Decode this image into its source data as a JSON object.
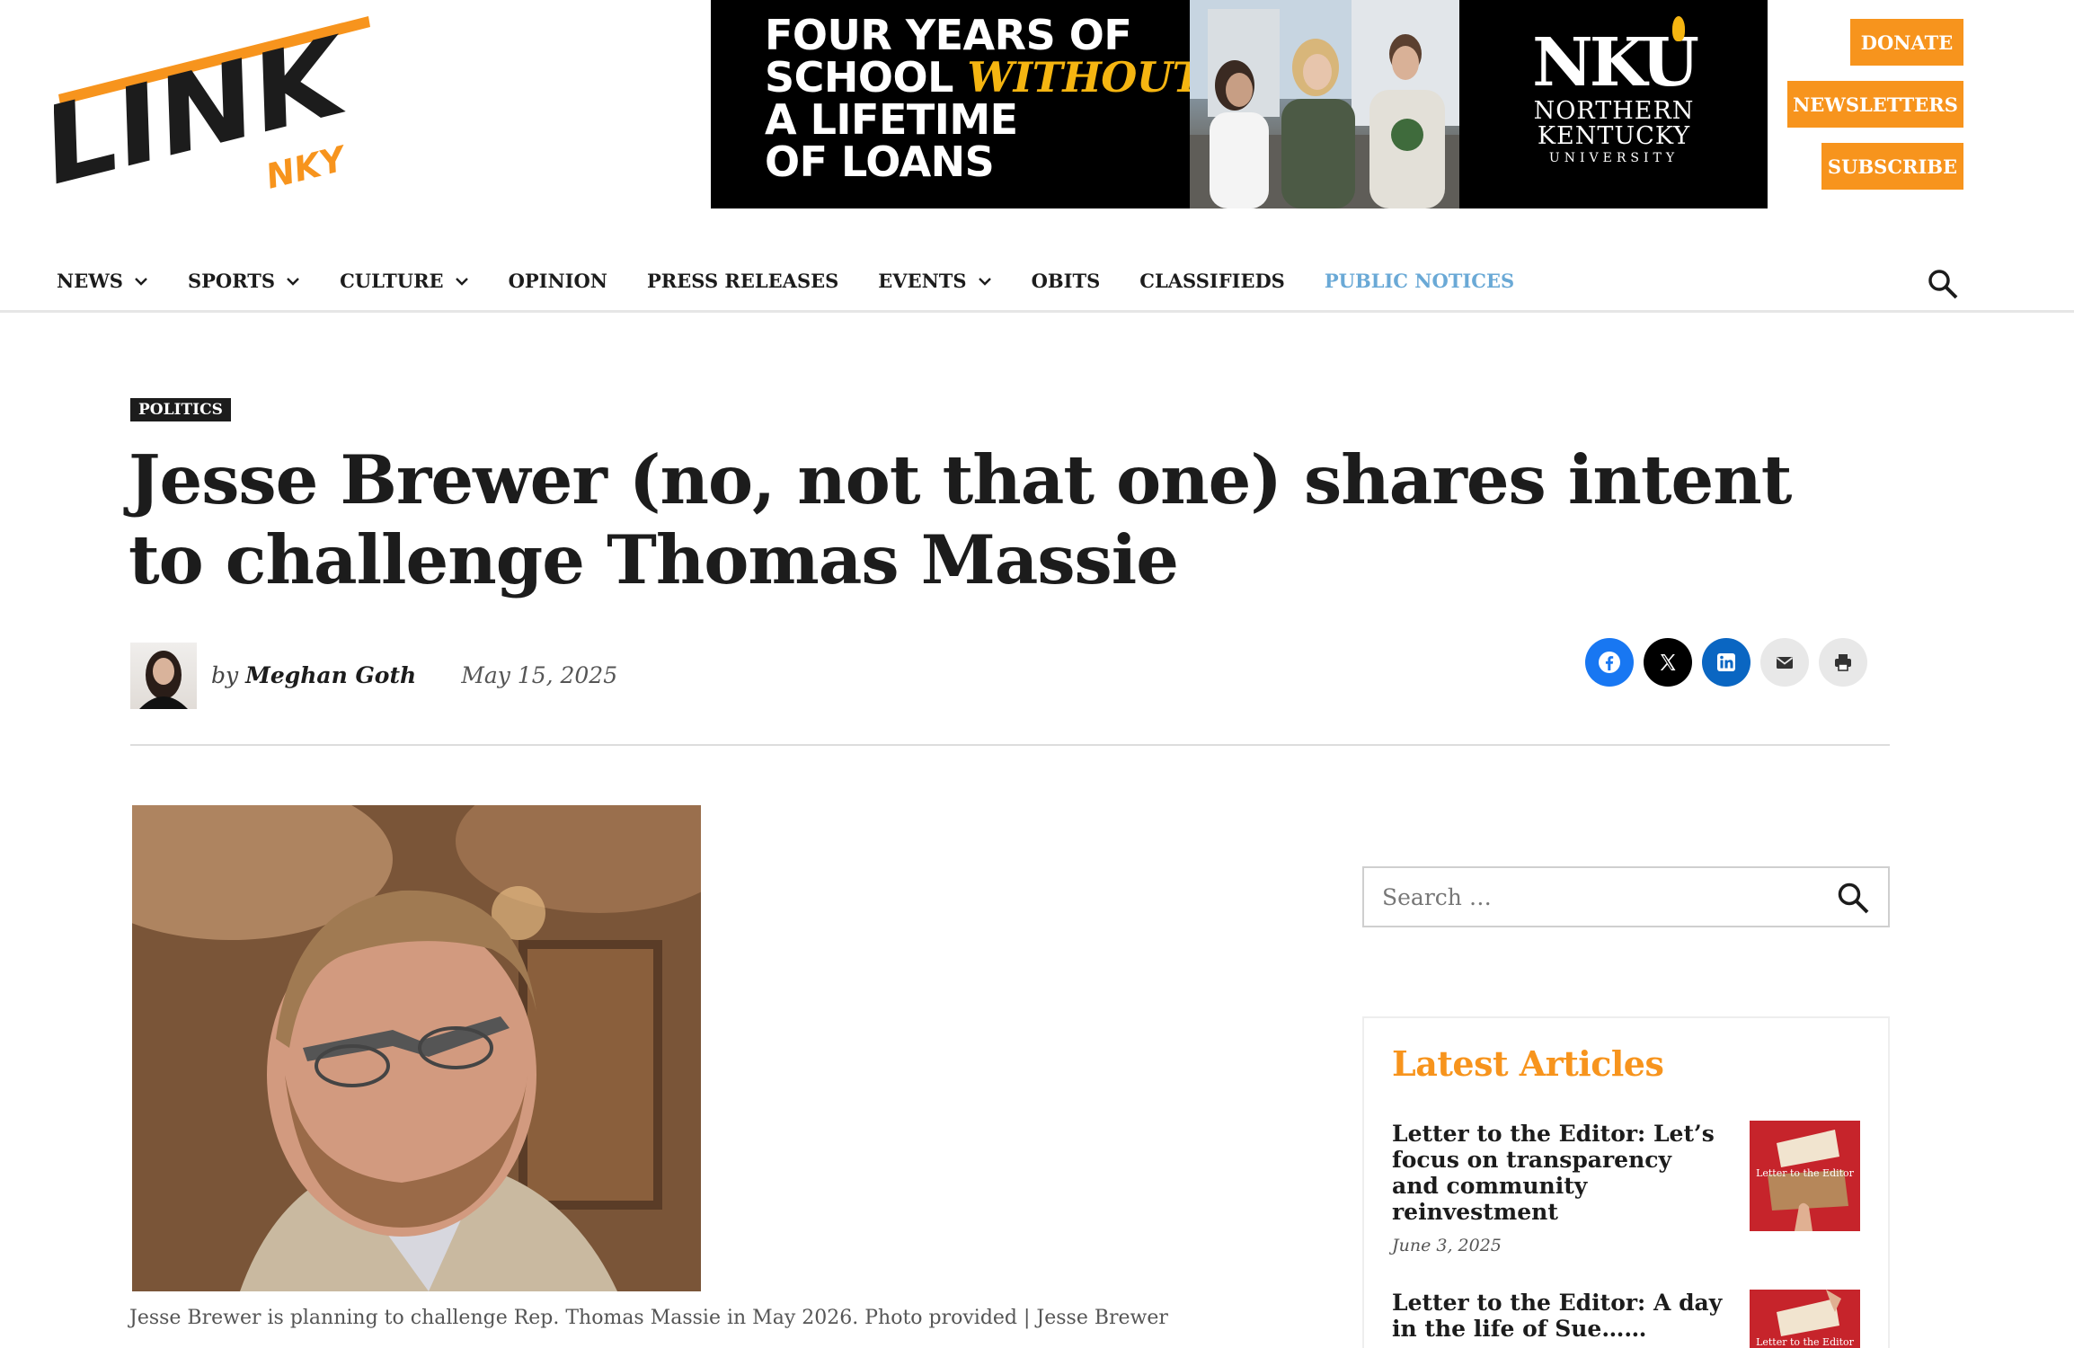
{
  "brand": {
    "logo_main": "LINK",
    "logo_sub": "NKY",
    "accent_color": "#f7941d",
    "dark_color": "#1c1c1c",
    "link_color": "#6aa9d6"
  },
  "ad": {
    "line1": "FOUR YEARS OF",
    "line2_a": "SCHOOL ",
    "line2_b": "WITHOUT",
    "line3": "A LIFETIME",
    "line4": "OF LOANS",
    "logo_mark": "NKU",
    "logo_line1": "NORTHERN",
    "logo_line2": "KENTUCKY",
    "logo_line3": "UNIVERSITY"
  },
  "header_buttons": {
    "donate": "DONATE",
    "newsletters": "NEWSLETTERS",
    "subscribe": "SUBSCRIBE"
  },
  "nav": {
    "items": [
      {
        "label": "NEWS",
        "dropdown": true
      },
      {
        "label": "SPORTS",
        "dropdown": true
      },
      {
        "label": "CULTURE",
        "dropdown": true
      },
      {
        "label": "OPINION",
        "dropdown": false
      },
      {
        "label": "PRESS RELEASES",
        "dropdown": false
      },
      {
        "label": "EVENTS",
        "dropdown": true
      },
      {
        "label": "OBITS",
        "dropdown": false
      },
      {
        "label": "CLASSIFIEDS",
        "dropdown": false
      },
      {
        "label": "PUBLIC NOTICES",
        "dropdown": false
      }
    ],
    "search_icon": "search-icon"
  },
  "article": {
    "category": "POLITICS",
    "headline": "Jesse Brewer (no, not that one) shares intent to challenge Thomas Massie",
    "byline_prefix": "by",
    "author": "Meghan Goth",
    "date": "May 15, 2025",
    "caption": "Jesse Brewer is planning to challenge Rep. Thomas Massie in May 2026. Photo provided | Jesse Brewer"
  },
  "share": {
    "icons": [
      "facebook-icon",
      "x-icon",
      "linkedin-icon",
      "email-icon",
      "print-icon"
    ]
  },
  "sidebar": {
    "search_placeholder": "Search …",
    "latest_title": "Latest Articles",
    "articles": [
      {
        "title": "Letter to the Editor: Let’s focus on transparency and community reinvestment",
        "date": "June 3, 2025",
        "thumb_label": "Letter to the Editor"
      },
      {
        "title": "Letter to the Editor: A day in the life of Sue……",
        "date": "",
        "thumb_label": "Letter to the Editor"
      }
    ]
  }
}
